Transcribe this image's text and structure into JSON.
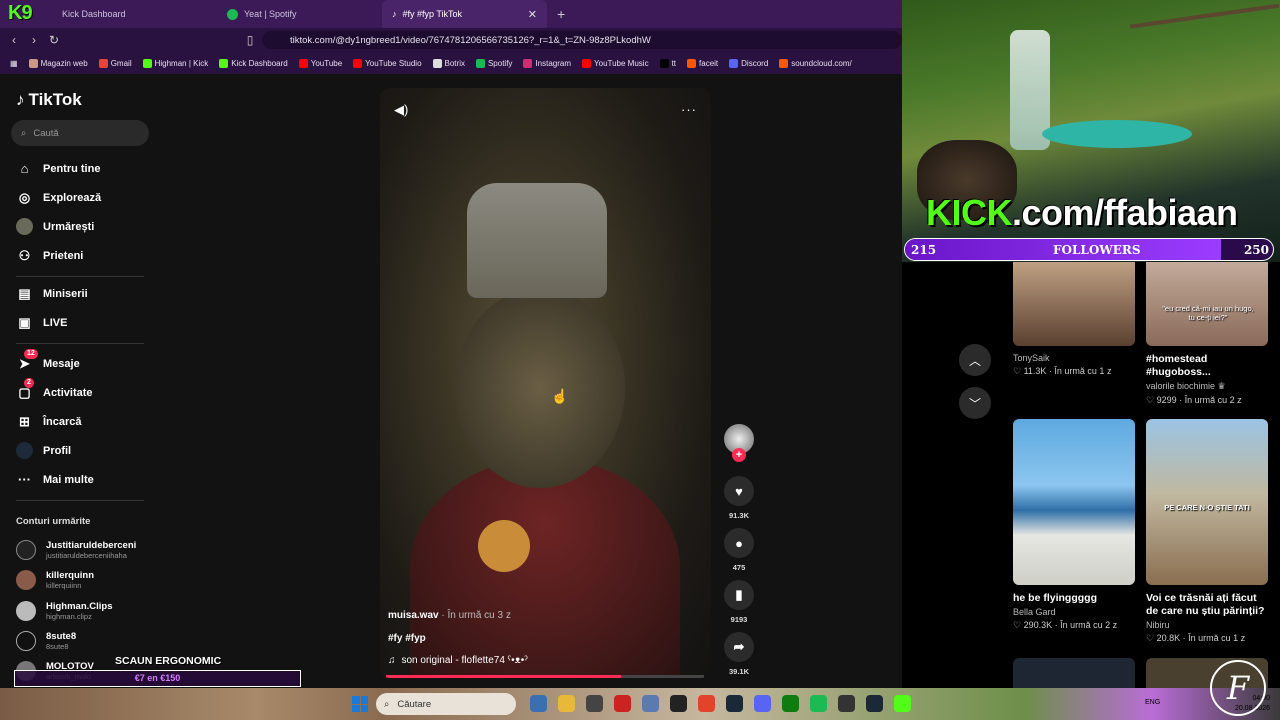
{
  "browser": {
    "tabs": [
      {
        "label": "Kick Dashboard"
      },
      {
        "label": "Yeat | Spotify"
      },
      {
        "label": "#fy #fyp TikTok"
      }
    ],
    "url": "tiktok.com/@dy1ngbreed1/video/7674781206566735126?_r=1&_t=ZN-98z8PLkodhW",
    "bookmarks": [
      "Magazin web",
      "Gmail",
      "Highman | Kick",
      "Kick Dashboard",
      "YouTube",
      "YouTube Studio",
      "Botrix",
      "Spotify",
      "Instagram",
      "YouTube Music",
      "tt",
      "faceit",
      "Discord",
      "soundcloud.com/"
    ]
  },
  "tiktok": {
    "logo": "TikTok",
    "search_placeholder": "Caută",
    "nav": [
      {
        "label": "Pentru tine",
        "icon": "home-icon"
      },
      {
        "label": "Explorează",
        "icon": "compass-icon"
      },
      {
        "label": "Urmărești",
        "icon": "avatar-icon"
      },
      {
        "label": "Prieteni",
        "icon": "friends-icon"
      },
      {
        "label": "Miniserii",
        "icon": "series-icon"
      },
      {
        "label": "LIVE",
        "icon": "live-icon"
      },
      {
        "label": "Mesaje",
        "icon": "messages-icon",
        "badge": "12"
      },
      {
        "label": "Activitate",
        "icon": "activity-icon",
        "badge": "2"
      },
      {
        "label": "Încarcă",
        "icon": "upload-icon"
      },
      {
        "label": "Profil",
        "icon": "profile-icon"
      },
      {
        "label": "Mai multe",
        "icon": "more-icon"
      }
    ],
    "following_title": "Conturi urmărite",
    "following": [
      {
        "name": "Justitiaruldeberceni",
        "handle": "justitiaruldeberceniihaha"
      },
      {
        "name": "killerquinn",
        "handle": "killerquiinn"
      },
      {
        "name": "Highman.Clips",
        "handle": "highman.clipz"
      },
      {
        "name": "8sute8",
        "handle": "8sute8"
      },
      {
        "name": "MOLOTOV",
        "handle": "artwork_molo"
      }
    ],
    "video": {
      "author": "muisa.wav",
      "time": "· În urmă cu 3 z",
      "caption": "#fy #fyp",
      "sound": "son original - floflette74 ˁ•ᴥ•ˀ",
      "progress": 0.74
    },
    "actions": {
      "likes": "91.3K",
      "comments": "475",
      "saves": "9193",
      "shares": "39.1K"
    },
    "recommended": [
      {
        "title": "",
        "author": "TonySaik",
        "stats": "♡ 11.3K · În urmă cu 1 z"
      },
      {
        "title": "#homestead #hugoboss...",
        "author": "valorile biochimie ♛",
        "stats": "♡ 9299 · În urmă cu 2 z"
      },
      {
        "title": "he be flyinggggg",
        "author": "Bella Gard",
        "stats": "♡ 290.3K · În urmă cu 2 z"
      },
      {
        "title": "Voi ce trăsnăi ați făcut de care nu știu părinții?",
        "author": "Nibiru",
        "stats": "♡ 20.8K · În urmă cu 1 z"
      }
    ],
    "thumb_captions": {
      "t2": "\"eu cred că-mi iau un hugo, tu ce-ți iei?\"",
      "t4": "PE CARE N-O ȘTIE TATI"
    }
  },
  "overlay": {
    "kick_prefix": "KICK",
    "kick_suffix": ".com/ffabiaan",
    "followers_current": "215",
    "followers_label": "FOLLOWERS",
    "followers_goal": "250",
    "followers_fraction": 0.86,
    "scaun": "SCAUN ERGONOMIC",
    "price": "€7 en €150",
    "watermark": "F"
  },
  "taskbar": {
    "search": "Căutare",
    "lang": "ENG",
    "time": "04:00",
    "date": "20.08.2026"
  },
  "colors": {
    "accent": "#fe2c55",
    "kick_green": "#53fc18",
    "tab_bg": "#3b1a57"
  }
}
